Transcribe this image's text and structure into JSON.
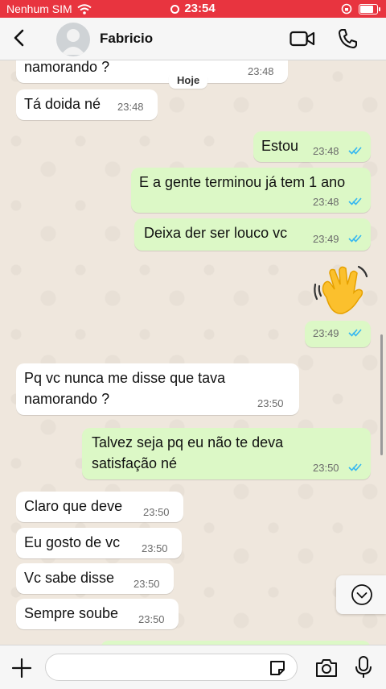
{
  "status_bar": {
    "carrier": "Nenhum SIM",
    "time": "23:54",
    "battery_level": 0.9
  },
  "header": {
    "contact_name": "Fabricio"
  },
  "chat": {
    "date_chip": "Hoje",
    "messages": [
      {
        "direction": "in",
        "text": "namorando ?",
        "time": "23:48"
      },
      {
        "direction": "in",
        "text": "Tá doida né",
        "time": "23:48"
      },
      {
        "direction": "out",
        "text": "Estou",
        "time": "23:48",
        "read": true
      },
      {
        "direction": "out",
        "text": "E a gente terminou já tem 1 ano",
        "time": "23:48",
        "read": true
      },
      {
        "direction": "out",
        "text": "Deixa der ser louco vc",
        "time": "23:49",
        "read": true
      },
      {
        "direction": "out",
        "text": "",
        "emoji": "waving-hand",
        "time": "23:49",
        "read": true
      },
      {
        "direction": "in",
        "text": "Pq vc nunca me disse que tava namorando ?",
        "time": "23:50"
      },
      {
        "direction": "out",
        "text": "Talvez seja pq eu não te deva satisfação né",
        "time": "23:50",
        "read": true
      },
      {
        "direction": "in",
        "text": "Claro que deve",
        "time": "23:50"
      },
      {
        "direction": "in",
        "text": "Eu gosto de vc",
        "time": "23:50"
      },
      {
        "direction": "in",
        "text": "Vc sabe disse",
        "time": "23:50"
      },
      {
        "direction": "in",
        "text": "Sempre soube",
        "time": "23:50"
      }
    ]
  },
  "input": {
    "placeholder": "",
    "value": ""
  },
  "colors": {
    "status_bar": "#e8343f",
    "outgoing_bubble": "#dcf8c6",
    "incoming_bubble": "#ffffff",
    "read_ticks": "#34b7f1",
    "icon": "#007aff"
  },
  "icons": [
    "wifi-icon",
    "battery-icon",
    "back-icon",
    "avatar",
    "video-call-icon",
    "phone-icon",
    "double-check-icon",
    "waving-hand-emoji",
    "chevron-down-icon",
    "plus-icon",
    "sticker-icon",
    "camera-icon",
    "mic-icon"
  ]
}
